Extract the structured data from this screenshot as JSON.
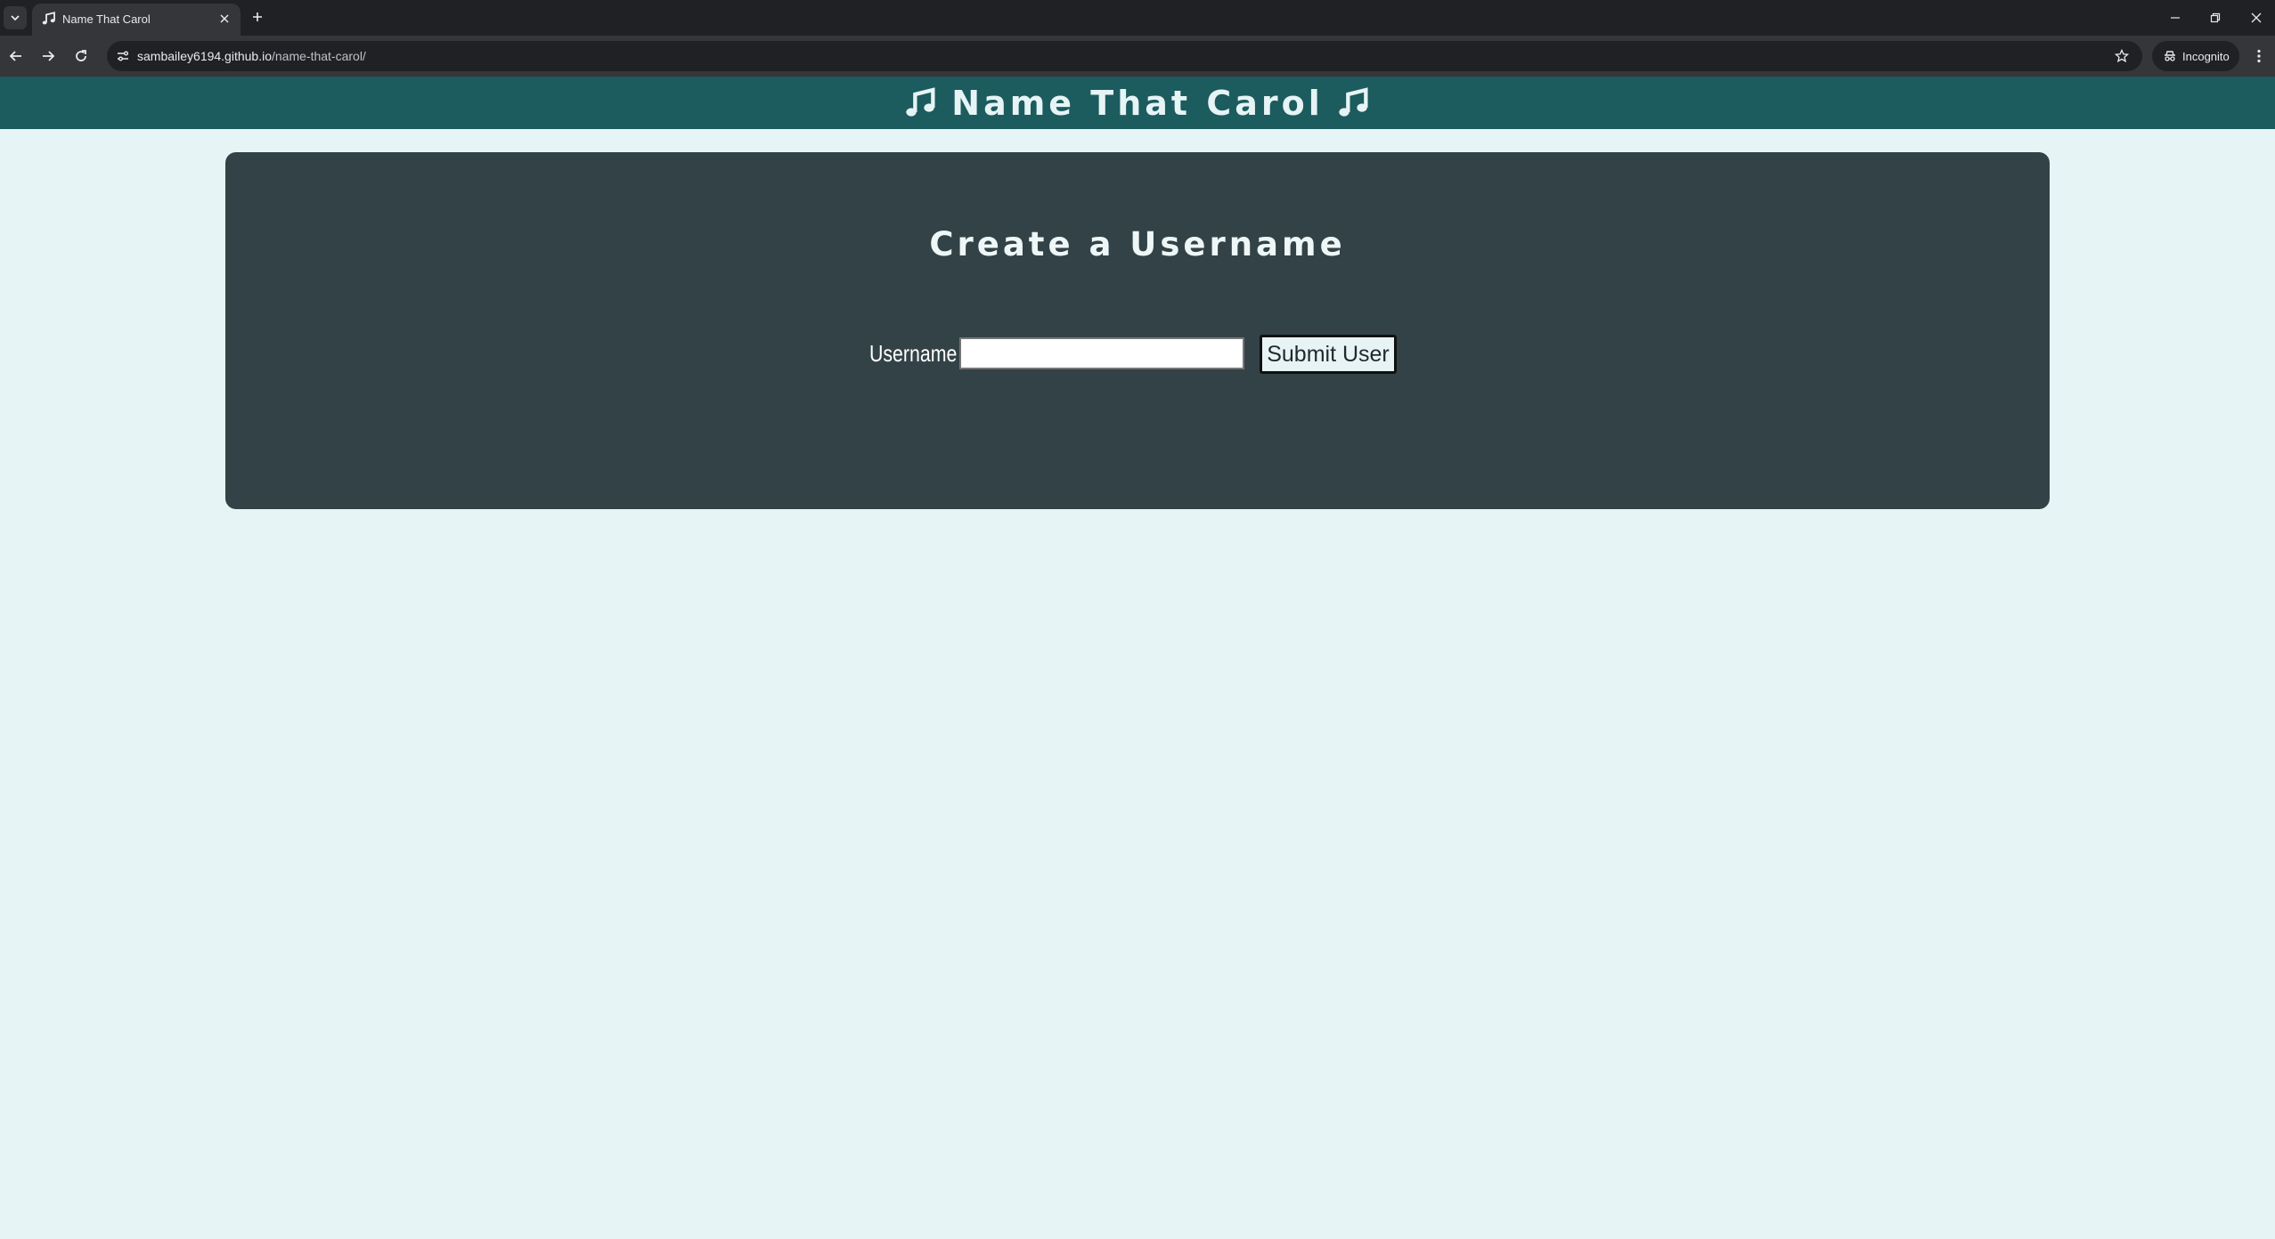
{
  "browser": {
    "tab_title": "Name That Carol",
    "url_host": "sambailey6194.github.io",
    "url_path": "/name-that-carol/",
    "incognito_label": "Incognito"
  },
  "header": {
    "title": "Name That Carol",
    "icon": "music-note-icon"
  },
  "card": {
    "heading": "Create a Username",
    "username_label": "Username",
    "username_value": "",
    "submit_label": "Submit User"
  },
  "colors": {
    "page_bg": "#e6f4f5",
    "header_bg": "#1c5b5e",
    "card_bg": "#334247",
    "button_bg": "#e7f3f4"
  }
}
